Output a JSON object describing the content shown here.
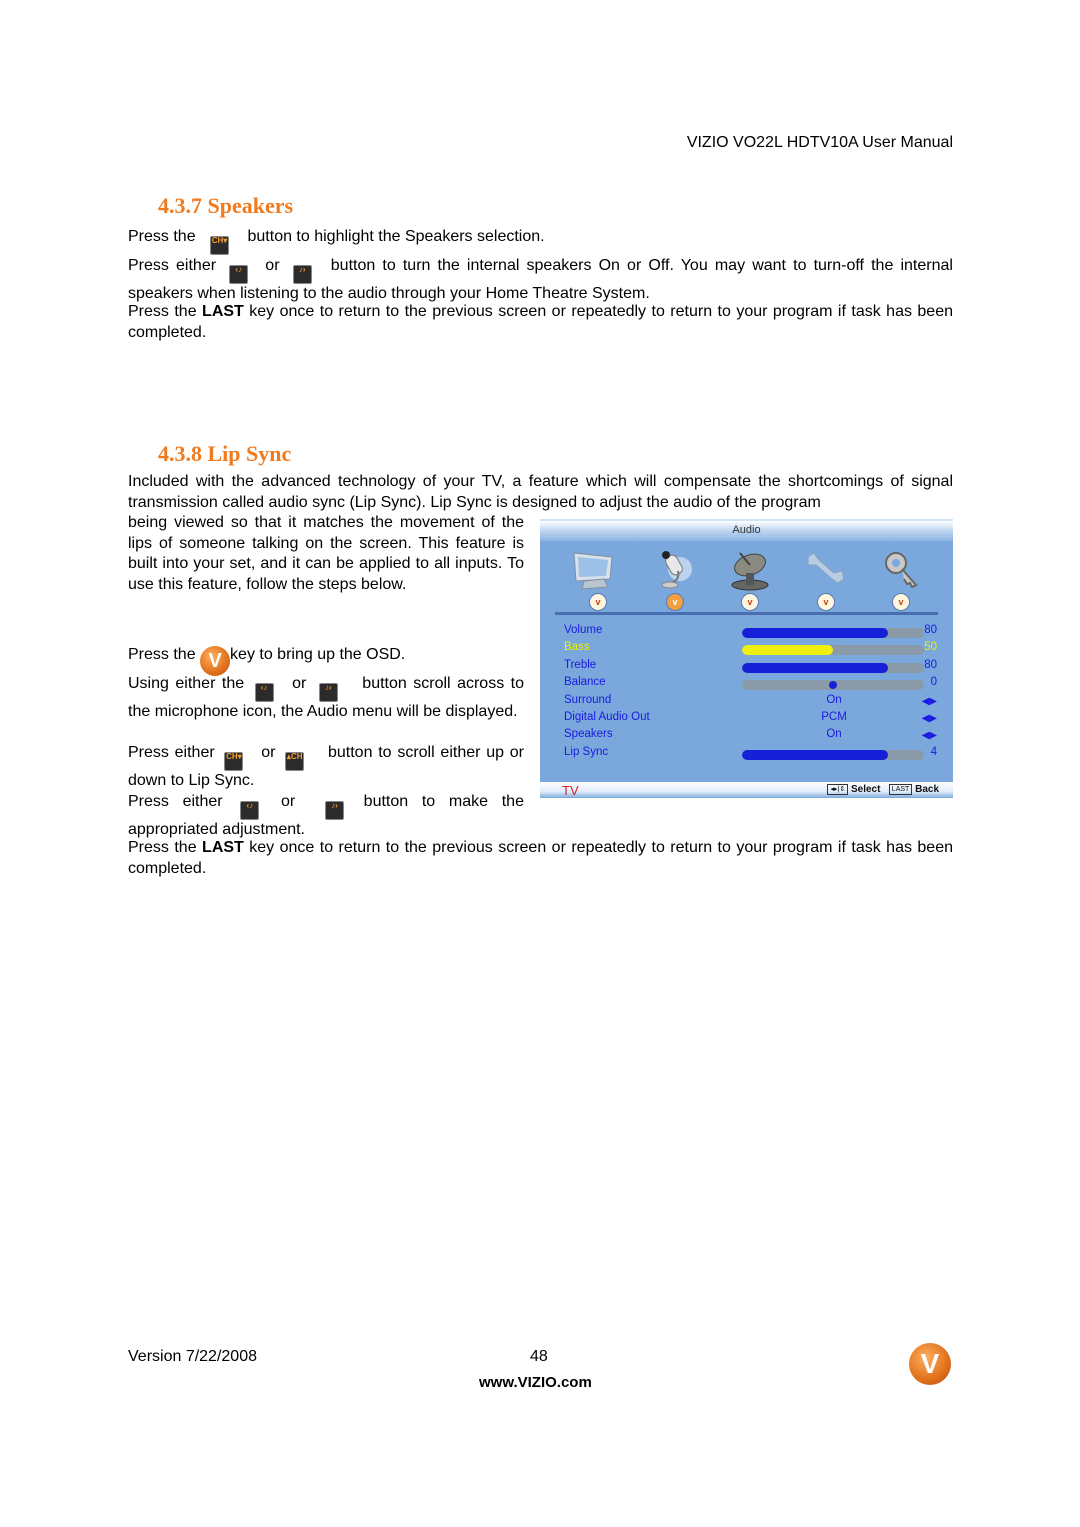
{
  "header": {
    "title": "VIZIO VO22L HDTV10A User Manual"
  },
  "speakers": {
    "heading": "4.3.7 Speakers",
    "p1_a": "Press the",
    "p1_b": "button to highlight the Speakers selection.",
    "p2_a": "Press either",
    "p2_or": "or",
    "p2_b": "button to turn the internal speakers On or Off.  You may want to turn-off the internal speakers when listening to the audio through your Home Theatre System.",
    "p3_a": "Press the ",
    "p3_key": "LAST",
    "p3_b": " key once to return to the previous screen or repeatedly to return to your program if task has been completed."
  },
  "lipsync": {
    "heading": "4.3.8 Lip Sync",
    "intro_full": "Included with the advanced technology of your TV, a feature which will compensate the shortcomings of signal transmission called audio sync (Lip Sync). Lip Sync is designed to adjust the audio of the program",
    "intro_cont": "being viewed so that it matches the movement of the lips of someone talking on the screen. This feature is built into your set, and it can be applied to all inputs. To use this feature, follow the steps below.",
    "step1_a": "Press the",
    "step1_b": "key to bring up the OSD.",
    "step2_a": "Using either the",
    "step2_or": "or",
    "step2_b": "button scroll across to the microphone icon, the Audio menu will be displayed.",
    "step3_a": "Press either",
    "step3_or": "or",
    "step3_b": "button to scroll either up or down to Lip Sync.",
    "step4_a": "Press either",
    "step4_or": "or",
    "step4_b": "button to make the appropriated adjustment.",
    "final_a": "Press the ",
    "final_key": "LAST",
    "final_b": " key once to return to the previous screen or repeatedly to return to your program if task has been completed."
  },
  "icons": {
    "ch_down": "CH▾",
    "ch_up": "▴CH",
    "vol_left": "‹♪",
    "vol_right": "♪›",
    "vizio_v": "V"
  },
  "osd": {
    "title": "Audio",
    "menu_icons": [
      "tv-picture-icon",
      "microphone-icon",
      "satellite-dish-icon",
      "wrench-icon",
      "key-icon"
    ],
    "active_icon_index": 1,
    "rows": [
      {
        "label": "Volume",
        "type": "bar",
        "value": "80",
        "level": 0.8
      },
      {
        "label": "Bass",
        "type": "bar",
        "value": "50",
        "level": 0.5,
        "selected": true
      },
      {
        "label": "Treble",
        "type": "bar",
        "value": "80",
        "level": 0.8
      },
      {
        "label": "Balance",
        "type": "knob",
        "value": "0",
        "level": 0.5
      },
      {
        "label": "Surround",
        "type": "option",
        "value": "On"
      },
      {
        "label": "Digital Audio Out",
        "type": "option",
        "value": "PCM"
      },
      {
        "label": "Speakers",
        "type": "option",
        "value": "On"
      },
      {
        "label": "Lip Sync",
        "type": "bar",
        "value": "4",
        "level": 0.8
      }
    ],
    "source": "TV",
    "hint_nav_key": "◂▸|⇕",
    "hint_select": "Select",
    "hint_last_key": "LAST",
    "hint_back": "Back"
  },
  "footer": {
    "version": "Version 7/22/2008",
    "page": "48",
    "url": "www.VIZIO.com",
    "logo": "V"
  }
}
